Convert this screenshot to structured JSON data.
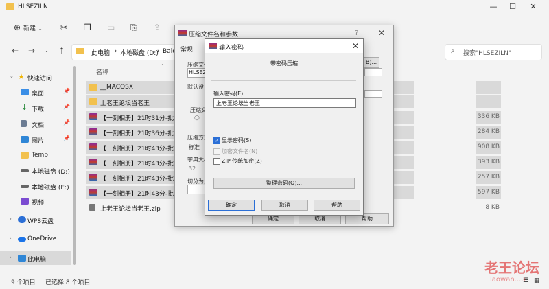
{
  "explorer": {
    "title": "HLSEZILN",
    "new_label": "新建",
    "address": [
      "此电脑",
      "本地磁盘 (D:)",
      "Baic"
    ],
    "search_placeholder": "搜索\"HLSEZILN\"",
    "column_name": "名称",
    "sidebar": [
      {
        "label": "快速访问",
        "icon": "star-icon",
        "color": "#f0b400"
      },
      {
        "label": "桌面",
        "icon": "desktop-icon",
        "color": "#3a8ee6"
      },
      {
        "label": "下载",
        "icon": "download-icon",
        "color": "#2b8a3e"
      },
      {
        "label": "文档",
        "icon": "document-icon",
        "color": "#6b7c93"
      },
      {
        "label": "图片",
        "icon": "picture-icon",
        "color": "#2f86d6"
      },
      {
        "label": "Temp",
        "icon": "folder-icon",
        "color": "#f2c14e"
      },
      {
        "label": "本地磁盘 (D:)",
        "icon": "drive-icon",
        "color": "#666666"
      },
      {
        "label": "本地磁盘 (E:)",
        "icon": "drive-icon",
        "color": "#666666"
      },
      {
        "label": "视频",
        "icon": "video-icon",
        "color": "#7b4bd1"
      },
      {
        "label": "WPS云盘",
        "icon": "cloud-icon",
        "color": "#2b6fd6"
      },
      {
        "label": "OneDrive",
        "icon": "onedrive-icon",
        "color": "#1a73e8"
      },
      {
        "label": "此电脑",
        "icon": "computer-icon",
        "color": "#2f86d6"
      }
    ],
    "files": [
      {
        "name": "__MACOSX",
        "size": "",
        "type": "folder"
      },
      {
        "name": "上老王论坛当老王",
        "size": "",
        "type": "folder"
      },
      {
        "name": "【一刻相册】21时31分-批量",
        "size": "336 KB",
        "type": "rar"
      },
      {
        "name": "【一刻相册】21时36分-批量",
        "size": "284 KB",
        "type": "rar"
      },
      {
        "name": "【一刻相册】21时43分-批量",
        "size": "908 KB",
        "type": "rar"
      },
      {
        "name": "【一刻相册】21时43分-批量",
        "size": "393 KB",
        "type": "rar"
      },
      {
        "name": "【一刻相册】21时43分-批量",
        "size": "257 KB",
        "type": "rar"
      },
      {
        "name": "【一刻相册】21时43分-批量",
        "size": "597 KB",
        "type": "rar"
      },
      {
        "name": "上老王论坛当老王.zip",
        "size": "8 KB",
        "type": "zip"
      }
    ],
    "status_count": "9 个项目",
    "status_selected": "已选择 8 个项目"
  },
  "archive_dialog": {
    "title": "压缩文件名和参数",
    "tab_general": "常规",
    "label_archive_name": "压缩文件",
    "archive_name_value": "HLSEZI",
    "label_default_settings": "默认设",
    "label_update_mode": "压缩文",
    "label_method": "压缩方式",
    "method_value": "标准",
    "label_dictionary": "字典大小",
    "dictionary_value": "32",
    "label_split": "切分为分",
    "ok_label": "确定",
    "cancel_label": "取消",
    "help_label": "帮助"
  },
  "password_dialog": {
    "title": "输入密码",
    "subtitle": "带密码压缩",
    "label_password": "输入密码(E)",
    "password_value": "上老王论坛当老王",
    "show_password": {
      "label": "显示密码(S)",
      "checked": true
    },
    "encrypt_names": {
      "label": "加密文件名(N)",
      "checked": false
    },
    "zip_legacy": {
      "label": "ZIP 传统加密(Z)",
      "checked": false
    },
    "organize_label": "整理密码(O)...",
    "ok_label": "确定",
    "cancel_label": "取消",
    "help_label": "帮助"
  },
  "watermark": {
    "text": "老王论坛",
    "sub": "laowan...u"
  }
}
